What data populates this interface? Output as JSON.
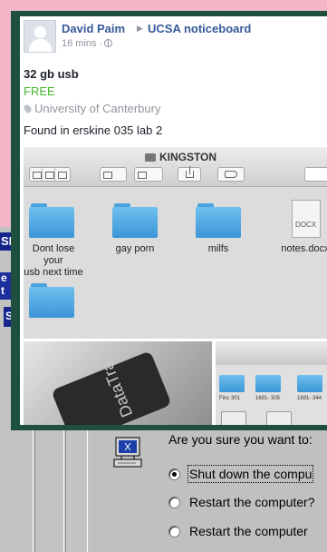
{
  "post": {
    "author": "David Paim",
    "group": "UCSA noticeboard",
    "time": "16 mins ·",
    "item_title": "32 gb usb",
    "price": "FREE",
    "location": "University of Canterbury",
    "description": "Found in erskine 035 lab 2"
  },
  "finder": {
    "title": "KINGSTON",
    "items": [
      {
        "label": "Dont lose your\nusb next time",
        "icon": "folder-icon"
      },
      {
        "label": "gay porn",
        "icon": "folder-icon"
      },
      {
        "label": "milfs",
        "icon": "folder-icon"
      },
      {
        "label": "notes.docx",
        "icon": "docx-file-icon"
      }
    ]
  },
  "usb_photo": {
    "brand": "DataTra"
  },
  "finder2": {
    "labels": [
      "Finc 301",
      "1691- 305",
      "1691- 344"
    ]
  },
  "background": {
    "left_strip_text": "SI",
    "left_bits": [
      "e",
      "t",
      "S"
    ]
  },
  "shutdown_dialog": {
    "question": "Are you sure you want to:",
    "options": [
      {
        "label": "Shut down the compu",
        "accelerator": "S",
        "checked": true
      },
      {
        "label": "Restart the computer?",
        "accelerator": "R",
        "checked": false
      },
      {
        "label": "Restart the computer",
        "accelerator": "",
        "checked": false
      }
    ]
  },
  "colors": {
    "pink": "#f2b6c6",
    "frame_green": "#1f4f3e",
    "fb_link": "#365899",
    "price_green": "#42b72a",
    "win_gray": "#c0c0c0",
    "win_blue": "#14258a"
  }
}
